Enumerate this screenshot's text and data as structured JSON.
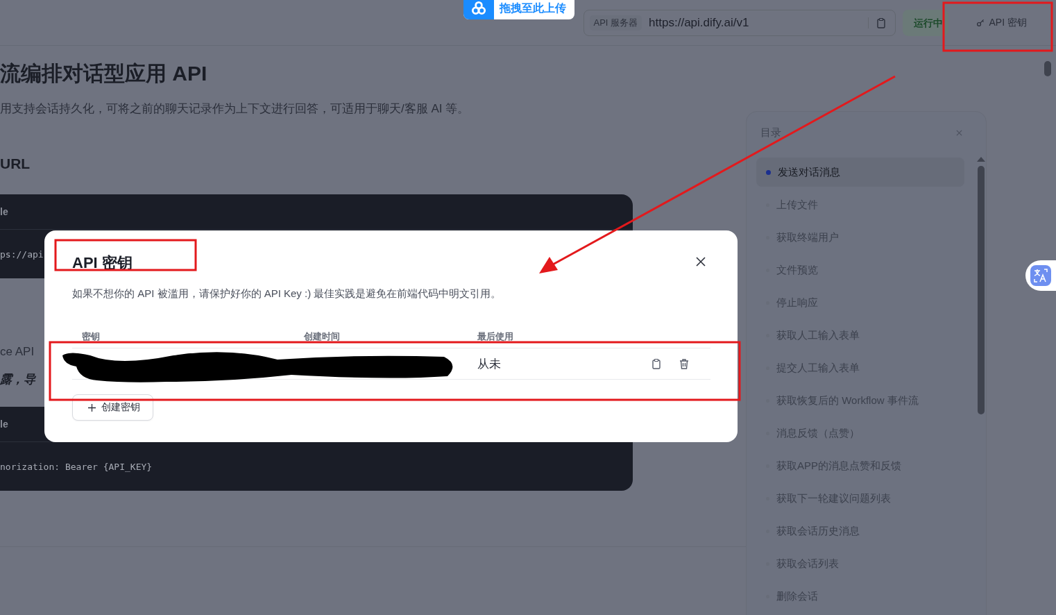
{
  "upload_badge": {
    "label": "拖拽至此上传"
  },
  "header": {
    "server_label": "API 服务器",
    "server_url": "https://api.dify.ai/v1",
    "status": "运行中",
    "api_key_button": "API 密钥"
  },
  "doc": {
    "title": "流编排对话型应用 API",
    "description": "用支持会话持久化，可将之前的聊天记录作为上下文进行回答，可适用于聊天/客服 AI 等。",
    "url_heading": "URL",
    "code_blocks": [
      {
        "header": "le",
        "line": "ps://api"
      },
      {
        "header": "le",
        "line": "norization: Bearer {API_KEY}"
      }
    ],
    "note": "ce API",
    "warning": "露，导"
  },
  "modal": {
    "title": "API 密钥",
    "description": "如果不想你的 API 被滥用，请保护好你的 API Key :) 最佳实践是避免在前端代码中明文引用。",
    "columns": [
      "密钥",
      "创建时间",
      "最后使用"
    ],
    "rows": [
      {
        "last_used": "从未"
      }
    ],
    "create_button": "创建密钥"
  },
  "toc": {
    "title": "目录",
    "items": [
      {
        "label": "发送对话消息",
        "selected": true
      },
      {
        "label": "上传文件",
        "selected": false
      },
      {
        "label": "获取终端用户",
        "selected": false
      },
      {
        "label": "文件预览",
        "selected": false
      },
      {
        "label": "停止响应",
        "selected": false
      },
      {
        "label": "获取人工输入表单",
        "selected": false
      },
      {
        "label": "提交人工输入表单",
        "selected": false
      },
      {
        "label": "获取恢复后的 Workflow 事件流",
        "selected": false
      },
      {
        "label": "消息反馈（点赞）",
        "selected": false
      },
      {
        "label": "获取APP的消息点赞和反馈",
        "selected": false
      },
      {
        "label": "获取下一轮建议问题列表",
        "selected": false
      },
      {
        "label": "获取会话历史消息",
        "selected": false
      },
      {
        "label": "获取会话列表",
        "selected": false
      },
      {
        "label": "删除会话",
        "selected": false
      }
    ]
  }
}
